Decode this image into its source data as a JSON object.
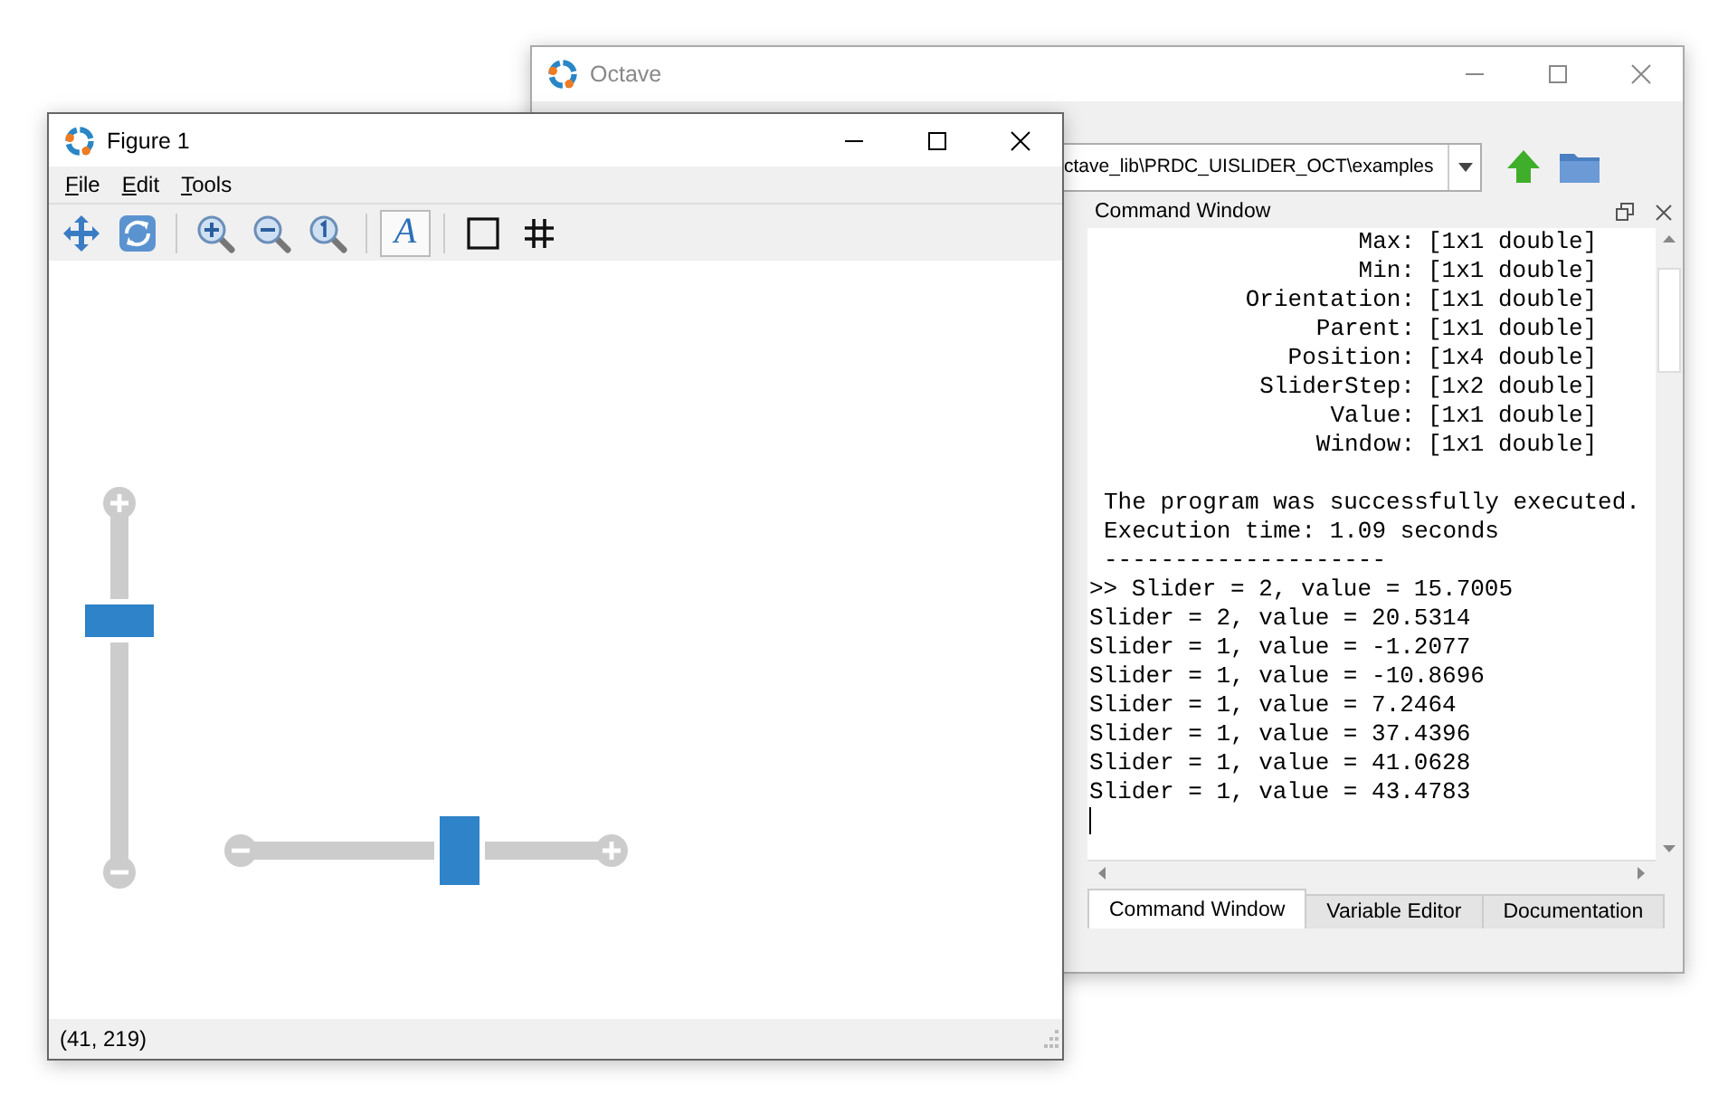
{
  "octave_window": {
    "title": "Octave",
    "path": "ctave_lib\\PRDC_UISLIDER_OCT\\examples",
    "command_window": {
      "title": "Command Window",
      "properties": [
        {
          "name": "Max:",
          "value": "[1x1 double]"
        },
        {
          "name": "Min:",
          "value": "[1x1 double]"
        },
        {
          "name": "Orientation:",
          "value": "[1x1 double]"
        },
        {
          "name": "Parent:",
          "value": "[1x1 double]"
        },
        {
          "name": "Position:",
          "value": "[1x4 double]"
        },
        {
          "name": "SliderStep:",
          "value": "[1x2 double]"
        },
        {
          "name": "Value:",
          "value": "[1x1 double]"
        },
        {
          "name": "Window:",
          "value": "[1x1 double]"
        }
      ],
      "messages": [
        "The program was successfully executed.",
        "Execution time: 1.09 seconds",
        "--------------------"
      ],
      "output_lines": [
        ">> Slider = 2, value = 15.7005",
        "Slider = 2, value = 20.5314",
        "Slider = 1, value = -1.2077",
        "Slider = 1, value = -10.8696",
        "Slider = 1, value = 7.2464",
        "Slider = 1, value = 37.4396",
        "Slider = 1, value = 41.0628",
        "Slider = 1, value = 43.4783"
      ]
    },
    "tabs": [
      {
        "label": "Command Window",
        "selected": true
      },
      {
        "label": "Variable Editor",
        "selected": false
      },
      {
        "label": "Documentation",
        "selected": false
      }
    ]
  },
  "figure_window": {
    "title": "Figure 1",
    "menu": [
      {
        "label": "File"
      },
      {
        "label": "Edit"
      },
      {
        "label": "Tools"
      }
    ],
    "toolbar": [
      {
        "kind": "pan",
        "pressed": false
      },
      {
        "kind": "rotate",
        "pressed": false
      },
      {
        "kind": "separator"
      },
      {
        "kind": "zoom-in",
        "pressed": false
      },
      {
        "kind": "zoom-out",
        "pressed": false
      },
      {
        "kind": "zoom-reset",
        "pressed": false
      },
      {
        "kind": "separator"
      },
      {
        "kind": "text",
        "glyph": "A",
        "pressed": true
      },
      {
        "kind": "separator"
      },
      {
        "kind": "box",
        "pressed": false
      },
      {
        "kind": "grid",
        "pressed": false
      }
    ],
    "sliders": [
      {
        "kind": "vertical",
        "level": 0.68
      },
      {
        "kind": "horizontal",
        "level": 0.59
      }
    ],
    "status": "(41, 219)"
  }
}
